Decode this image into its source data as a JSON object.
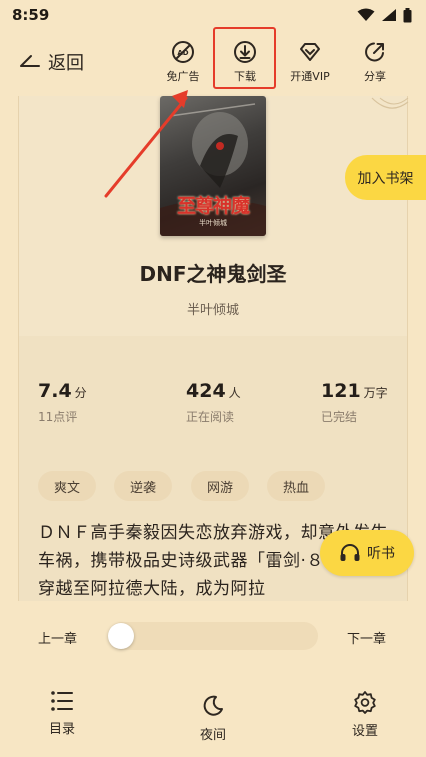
{
  "status_bar": {
    "time": "8:59"
  },
  "top_bar": {
    "back_label": "返回",
    "tools": [
      {
        "label": "免广告",
        "icon": "ad-free-icon"
      },
      {
        "label": "下载",
        "icon": "download-icon"
      },
      {
        "label": "开通VIP",
        "icon": "vip-diamond-icon"
      },
      {
        "label": "分享",
        "icon": "share-icon"
      }
    ]
  },
  "book": {
    "cover_title": "至尊神魔",
    "cover_author": "半叶倾城",
    "title": "DNF之神鬼剑圣",
    "author": "半叶倾城",
    "add_to_shelf": "加入书架",
    "stats": [
      {
        "value": "7.4",
        "unit": "分",
        "sub": "11点评"
      },
      {
        "value": "424",
        "unit": "人",
        "sub": "正在阅读"
      },
      {
        "value": "121",
        "unit": "万字",
        "sub": "已完结"
      }
    ],
    "tags": [
      "爽文",
      "逆袭",
      "网游",
      "热血"
    ],
    "synopsis": "ＤＮＦ高手秦毅因失恋放弃游戏，却意外发生车祸，携带极品史诗级武器「雷剑·８逸龙剑」穿越至阿拉德大陆，成为阿拉"
  },
  "listen_button": "听书",
  "reader_controls": {
    "prev_chapter": "上一章",
    "next_chapter": "下一章",
    "progress": 0
  },
  "bottom_nav": [
    {
      "label": "目录",
      "icon": "list-icon"
    },
    {
      "label": "夜间",
      "icon": "moon-icon"
    },
    {
      "label": "设置",
      "icon": "gear-icon"
    }
  ],
  "colors": {
    "background": "#f7e6c4",
    "accent_yellow": "#fbd743",
    "highlight_red": "#e53c2a"
  }
}
